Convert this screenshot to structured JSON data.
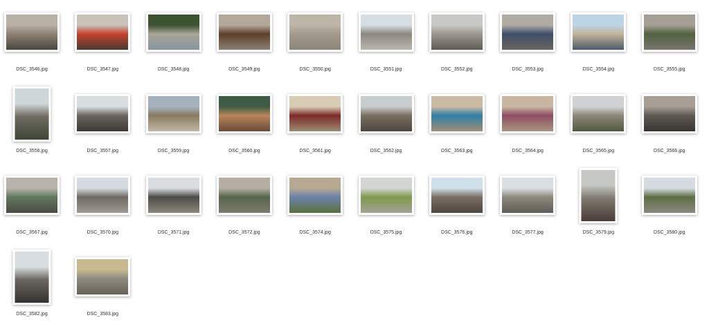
{
  "files": [
    {
      "name": "DSC_3546.jpg",
      "orientation": "landscape",
      "palette": [
        "#b9b0a6",
        "#8d8174",
        "#49463f"
      ]
    },
    {
      "name": "DSC_3547.jpg",
      "orientation": "landscape",
      "palette": [
        "#c9c2b8",
        "#c8412f",
        "#4a3b33"
      ]
    },
    {
      "name": "DSC_3548.jpg",
      "orientation": "landscape",
      "palette": [
        "#3d5133",
        "#a9a497",
        "#8696a0"
      ]
    },
    {
      "name": "DSC_3549.jpg",
      "orientation": "landscape",
      "palette": [
        "#b3a99b",
        "#5e3f2a",
        "#8a8174"
      ]
    },
    {
      "name": "DSC_3550.jpg",
      "orientation": "landscape",
      "palette": [
        "#bdb5a8",
        "#a29a8d",
        "#8d8579"
      ]
    },
    {
      "name": "DSC_3551.jpg",
      "orientation": "landscape",
      "palette": [
        "#d6dde3",
        "#8c8880",
        "#bcb7ae"
      ]
    },
    {
      "name": "DSC_3552.jpg",
      "orientation": "landscape",
      "palette": [
        "#c8c8c4",
        "#9c968d",
        "#5f5b55"
      ]
    },
    {
      "name": "DSC_3553.jpg",
      "orientation": "landscape",
      "palette": [
        "#b0aca4",
        "#3e4f6b",
        "#6b645d"
      ]
    },
    {
      "name": "DSC_3554.jpg",
      "orientation": "landscape",
      "palette": [
        "#bdd4e6",
        "#c2b49a",
        "#4c5a6b"
      ]
    },
    {
      "name": "DSC_3555.jpg",
      "orientation": "landscape",
      "palette": [
        "#a59f96",
        "#51613f",
        "#7b7670"
      ]
    },
    {
      "name": "DSC_3556.jpg",
      "orientation": "portrait",
      "palette": [
        "#cfd6da",
        "#6f6a5f",
        "#3d4636"
      ]
    },
    {
      "name": "DSC_3557.jpg",
      "orientation": "landscape",
      "palette": [
        "#d8dde0",
        "#6a655d",
        "#3c3a36"
      ]
    },
    {
      "name": "DSC_3559.jpg",
      "orientation": "landscape",
      "palette": [
        "#a5b2be",
        "#8a7a5f",
        "#c2b8a6"
      ]
    },
    {
      "name": "DSC_3560.jpg",
      "orientation": "landscape",
      "palette": [
        "#3f5a45",
        "#b7865a",
        "#6b4a3a"
      ]
    },
    {
      "name": "DSC_3561.jpg",
      "orientation": "landscape",
      "palette": [
        "#d9ccb4",
        "#7c2a28",
        "#9a8b72"
      ]
    },
    {
      "name": "DSC_3562.jpg",
      "orientation": "landscape",
      "palette": [
        "#c7ccce",
        "#7a6f62",
        "#4c4741"
      ]
    },
    {
      "name": "DSC_3563.jpg",
      "orientation": "landscape",
      "palette": [
        "#cbbba2",
        "#2f7fa7",
        "#a08e74"
      ]
    },
    {
      "name": "DSC_3564.jpg",
      "orientation": "landscape",
      "palette": [
        "#c8b6a2",
        "#8e4d63",
        "#a99580"
      ]
    },
    {
      "name": "DSC_3565.jpg",
      "orientation": "landscape",
      "palette": [
        "#cfd2d4",
        "#8f877a",
        "#4f5a3f"
      ]
    },
    {
      "name": "DSC_3566.jpg",
      "orientation": "landscape",
      "palette": [
        "#a79f94",
        "#5e5a53",
        "#373432"
      ]
    },
    {
      "name": "DSC_3567.jpg",
      "orientation": "landscape",
      "palette": [
        "#b8b3ab",
        "#5f7a5c",
        "#4c4a46"
      ]
    },
    {
      "name": "DSC_3570.jpg",
      "orientation": "landscape",
      "palette": [
        "#d5dbe0",
        "#6e6a63",
        "#9f9a92"
      ]
    },
    {
      "name": "DSC_3571.jpg",
      "orientation": "landscape",
      "palette": [
        "#d9dde0",
        "#4c4c48",
        "#8c877d"
      ]
    },
    {
      "name": "DSC_3572.jpg",
      "orientation": "landscape",
      "palette": [
        "#b4aea3",
        "#55664a",
        "#7f7a70"
      ]
    },
    {
      "name": "DSC_3574.jpg",
      "orientation": "landscape",
      "palette": [
        "#b6a891",
        "#6c82a8",
        "#59703f"
      ]
    },
    {
      "name": "DSC_3575.jpg",
      "orientation": "landscape",
      "palette": [
        "#d2d5d2",
        "#7e9a4d",
        "#a5a197"
      ]
    },
    {
      "name": "DSC_3576.jpg",
      "orientation": "landscape",
      "palette": [
        "#cfe0ea",
        "#7a6e62",
        "#4d4741"
      ]
    },
    {
      "name": "DSC_3577.jpg",
      "orientation": "landscape",
      "palette": [
        "#d9dfe3",
        "#8f887c",
        "#5f5d58"
      ]
    },
    {
      "name": "DSC_3579.jpg",
      "orientation": "portrait",
      "palette": [
        "#c5c7c2",
        "#7f7a70",
        "#4a3b36"
      ]
    },
    {
      "name": "DSC_3580.jpg",
      "orientation": "landscape",
      "palette": [
        "#d5dbe0",
        "#5d6e45",
        "#8c8780"
      ]
    },
    {
      "name": "DSC_3582.jpg",
      "orientation": "portrait",
      "palette": [
        "#d8dde1",
        "#6a6660",
        "#343230"
      ]
    },
    {
      "name": "DSC_3583.jpg",
      "orientation": "landscape",
      "palette": [
        "#c9b98f",
        "#8e8a80",
        "#676258"
      ]
    }
  ]
}
